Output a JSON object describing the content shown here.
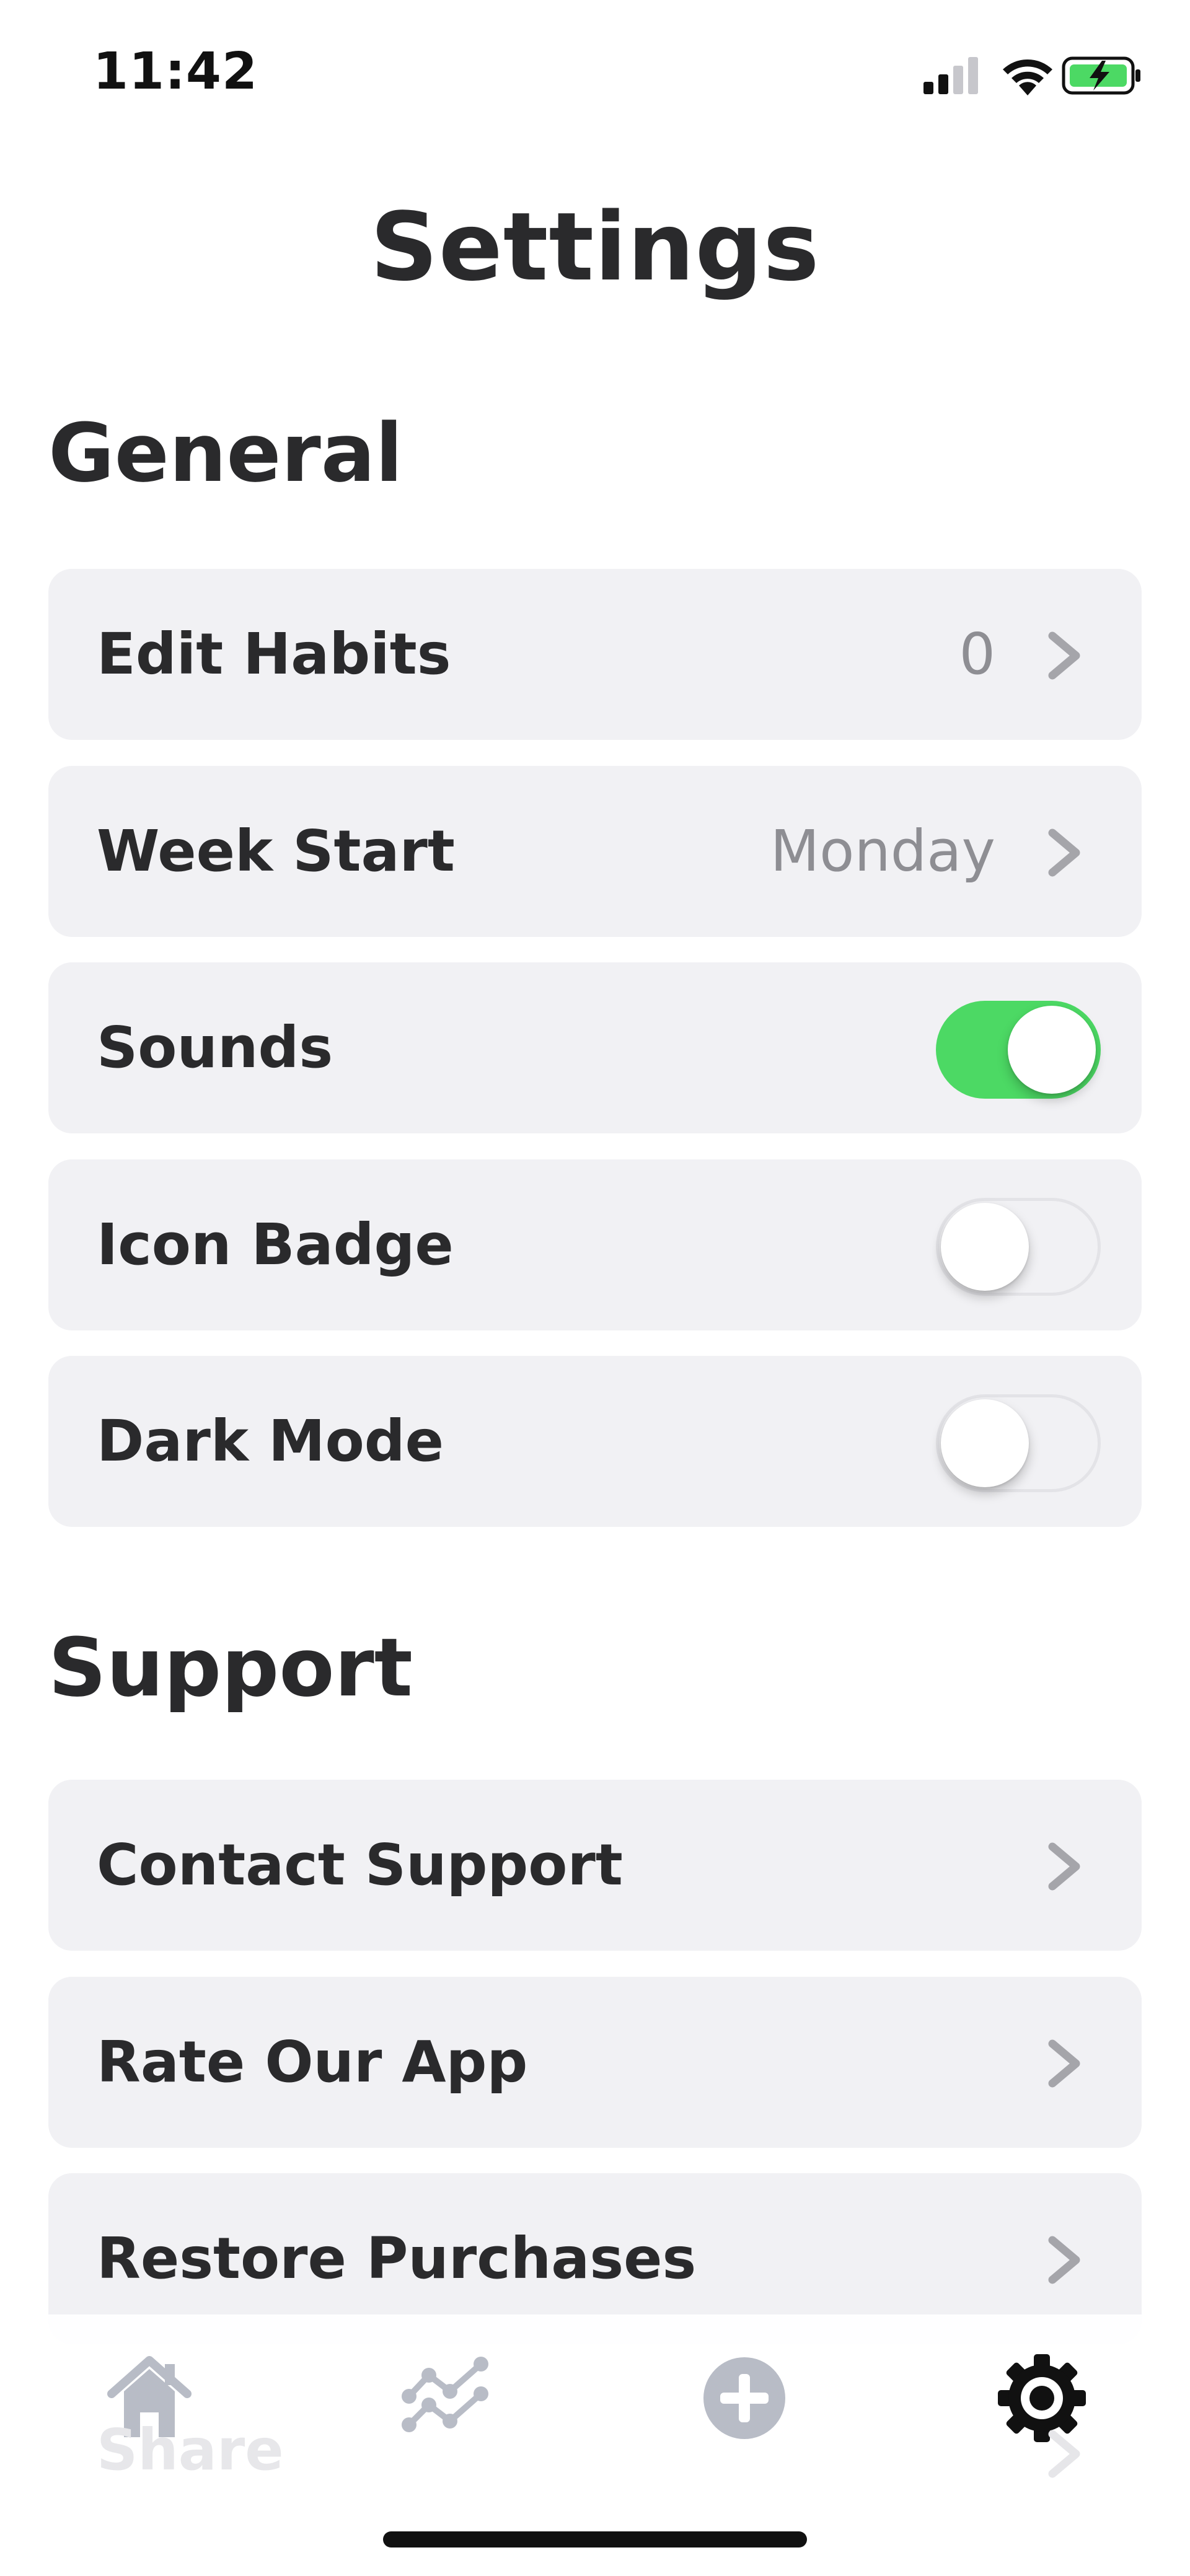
{
  "status_bar": {
    "time": "11:42"
  },
  "page": {
    "title": "Settings"
  },
  "sections": {
    "general": {
      "title": "General",
      "edit_habits": {
        "label": "Edit Habits",
        "value": "0"
      },
      "week_start": {
        "label": "Week Start",
        "value": "Monday"
      },
      "sounds": {
        "label": "Sounds",
        "enabled": true
      },
      "icon_badge": {
        "label": "Icon Badge",
        "enabled": false
      },
      "dark_mode": {
        "label": "Dark Mode",
        "enabled": false
      }
    },
    "support": {
      "title": "Support",
      "contact_support": {
        "label": "Contact Support"
      },
      "rate_app": {
        "label": "Rate Our App"
      },
      "restore_purchases": {
        "label": "Restore Purchases"
      },
      "share": {
        "label": "Share"
      }
    }
  },
  "tab_bar": {
    "items": [
      {
        "icon": "home-icon",
        "active": false
      },
      {
        "icon": "stats-icon",
        "active": false
      },
      {
        "icon": "add-circle-icon",
        "active": false
      },
      {
        "icon": "gear-icon",
        "active": true
      }
    ]
  },
  "colors": {
    "accent_green": "#4cd964",
    "row_background": "#f1f1f4",
    "text_primary": "#2a2a2c",
    "text_secondary": "#8e8e93",
    "tab_inactive": "#b8bcc6",
    "tab_active": "#111111"
  }
}
